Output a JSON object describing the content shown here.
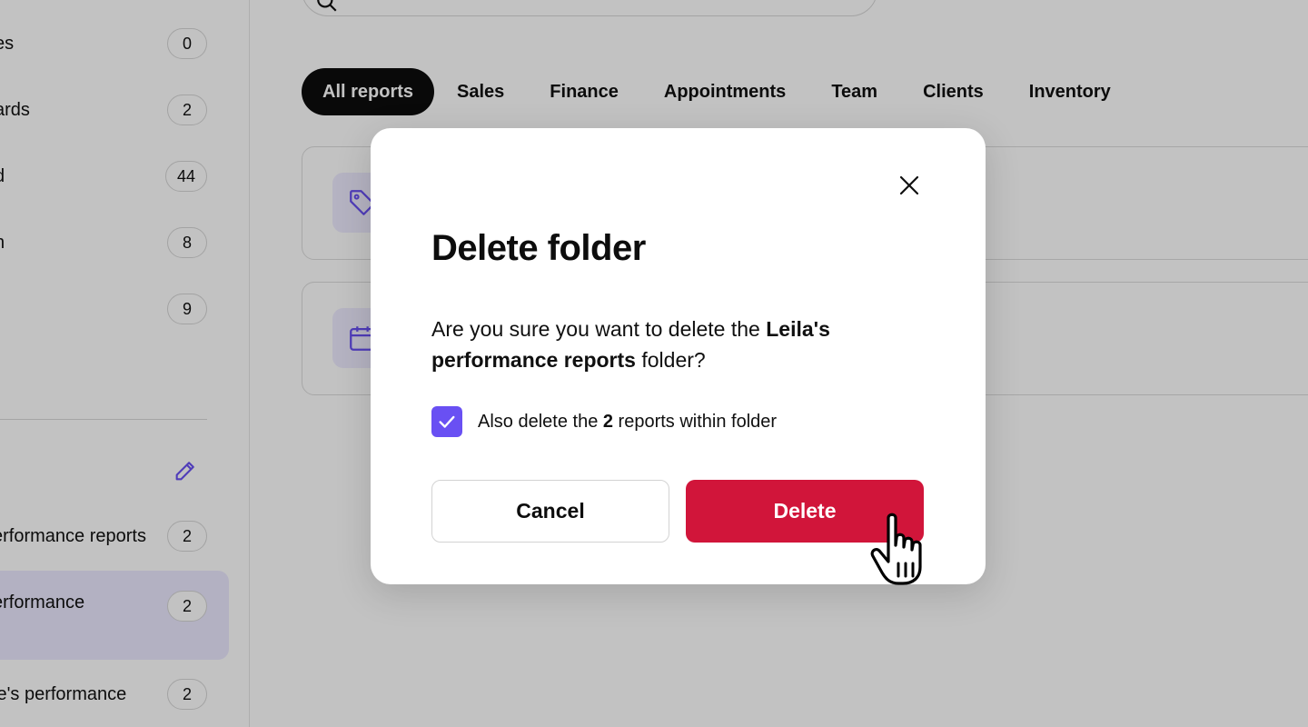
{
  "sidebar": {
    "categories": [
      {
        "label": "es",
        "count": "0"
      },
      {
        "label": "ards",
        "count": "2"
      },
      {
        "label": "d",
        "count": "44"
      },
      {
        "label": "n",
        "count": "8"
      },
      {
        "label": "",
        "count": "9"
      }
    ],
    "folders": [
      {
        "label": "erformance reports",
        "count": "2"
      },
      {
        "label": "erformance",
        "count": "2"
      },
      {
        "label": "le's performance",
        "count": "2"
      }
    ],
    "active_folder_bg": "#ebe9ff"
  },
  "tabs": [
    {
      "label": "All reports",
      "active": true
    },
    {
      "label": "Sales"
    },
    {
      "label": "Finance"
    },
    {
      "label": "Appointments"
    },
    {
      "label": "Team"
    },
    {
      "label": "Clients"
    },
    {
      "label": "Inventory"
    }
  ],
  "cards": [
    {
      "icon": "tag-icon"
    },
    {
      "icon": "calendar-icon"
    }
  ],
  "modal": {
    "title": "Delete folder",
    "message_prefix": "Are you sure you want to delete the ",
    "folder_name": "Leila's performance reports",
    "message_suffix": " folder?",
    "checkbox_checked": true,
    "checkbox_prefix": "Also delete the ",
    "checkbox_count": "2",
    "checkbox_suffix": " reports within folder",
    "cancel_label": "Cancel",
    "delete_label": "Delete"
  },
  "colors": {
    "accent": "#6950f3",
    "danger": "#d1153a",
    "active_tab": "#0d0d0d"
  }
}
